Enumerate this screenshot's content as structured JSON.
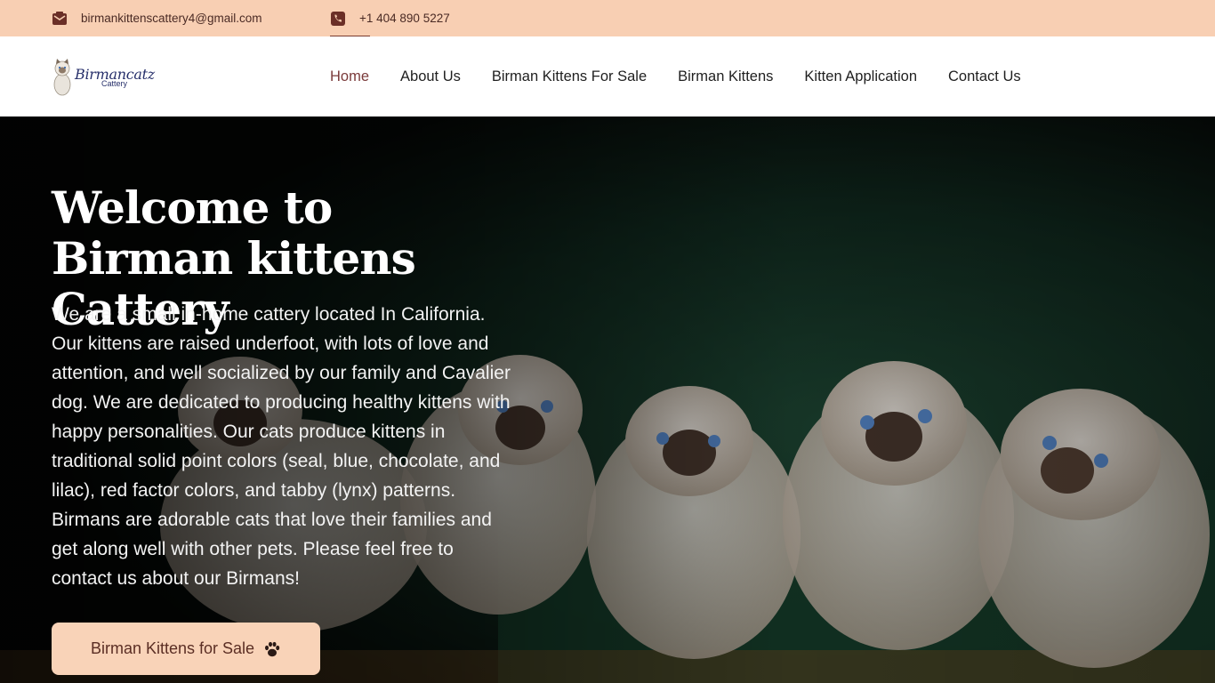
{
  "topbar": {
    "email": "birmankittenscattery4@gmail.com",
    "phone": "+1 404 890 5227",
    "email_icon": "envelope-icon",
    "phone_icon": "phone-icon"
  },
  "header": {
    "logo_name": "Birmancatz",
    "logo_sub": "Cattery",
    "nav": [
      {
        "label": "Home",
        "active": true
      },
      {
        "label": "About Us"
      },
      {
        "label": "Birman Kittens For Sale"
      },
      {
        "label": "Birman Kittens"
      },
      {
        "label": "Kitten Application"
      },
      {
        "label": "Contact Us"
      }
    ]
  },
  "hero": {
    "title": "Welcome to Birman kittens Cattery",
    "description": "We are a small in-home cattery located In California. Our kittens are raised underfoot, with lots of love and attention, and well socialized by our family and Cavalier dog. We are dedicated to producing healthy kittens with happy personalities. Our cats produce kittens in traditional solid point colors (seal, blue, chocolate, and lilac), red factor colors, and tabby (lynx) patterns. Birmans are adorable cats that love their families and get along well with other pets. Please feel free to contact us about our Birmans!",
    "cta_label": "Birman Kittens for Sale",
    "cta_icon": "paw-icon"
  },
  "colors": {
    "topbar_bg": "#f8cfb3",
    "accent": "#7a3a3a",
    "cta_bg": "#f9d3b8"
  }
}
